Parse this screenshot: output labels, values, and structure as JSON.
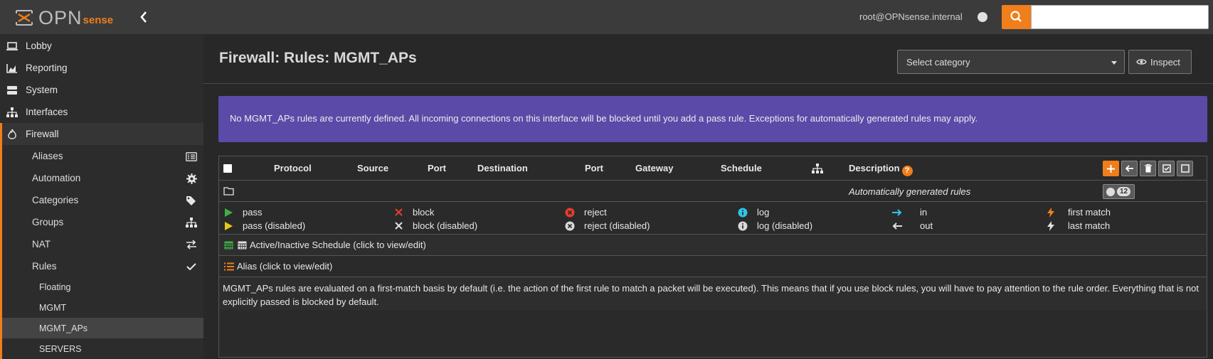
{
  "header": {
    "logo_text": "OPN",
    "logo_suffix": "sense",
    "user": "root@OPNsense.internal",
    "search_placeholder": ""
  },
  "sidebar": {
    "items": [
      {
        "label": "Lobby",
        "icon": "laptop-icon"
      },
      {
        "label": "Reporting",
        "icon": "area-chart-icon"
      },
      {
        "label": "System",
        "icon": "server-icon"
      },
      {
        "label": "Interfaces",
        "icon": "sitemap-icon"
      },
      {
        "label": "Firewall",
        "icon": "fire-icon"
      }
    ],
    "firewall_sub": [
      {
        "label": "Aliases",
        "icon": "list-alt-icon"
      },
      {
        "label": "Automation",
        "icon": "cog-icon"
      },
      {
        "label": "Categories",
        "icon": "tags-icon"
      },
      {
        "label": "Groups",
        "icon": "sitemap-icon"
      },
      {
        "label": "NAT",
        "icon": "exchange-icon"
      },
      {
        "label": "Rules",
        "icon": "check-icon"
      }
    ],
    "rules_sub": [
      "Floating",
      "MGMT",
      "MGMT_APs",
      "SERVERS"
    ]
  },
  "main": {
    "title": "Firewall: Rules: MGMT_APs",
    "category_select": "Select category",
    "inspect_label": "Inspect",
    "alert": "No MGMT_APs rules are currently defined. All incoming connections on this interface will be blocked until you add a pass rule. Exceptions for automatically generated rules may apply.",
    "columns": {
      "protocol": "Protocol",
      "source": "Source",
      "port1": "Port",
      "destination": "Destination",
      "port2": "Port",
      "gateway": "Gateway",
      "schedule": "Schedule",
      "description": "Description"
    },
    "autogen_label": "Automatically generated rules",
    "autogen_count": "12",
    "legend": {
      "pass": "pass",
      "pass_disabled": "pass (disabled)",
      "block": "block",
      "block_disabled": "block (disabled)",
      "reject": "reject",
      "reject_disabled": "reject (disabled)",
      "log": "log",
      "log_disabled": "log (disabled)",
      "in": "in",
      "out": "out",
      "first_match": "first match",
      "last_match": "last match"
    },
    "schedule_label": "Active/Inactive Schedule (click to view/edit)",
    "alias_label": "Alias (click to view/edit)",
    "info": "MGMT_APs rules are evaluated on a first-match basis by default (i.e. the action of the first rule to match a packet will be executed). This means that if you use block rules, you will have to pay attention to the rule order. Everything that is not explicitly passed is blocked by default."
  },
  "colors": {
    "accent": "#f07e1b",
    "alert_bg": "#5b4aa8",
    "pass": "#3fae49",
    "pass_disabled": "#e6c619",
    "block": "#e53e2d",
    "reject": "#e53e2d",
    "log": "#2fc4e8"
  }
}
